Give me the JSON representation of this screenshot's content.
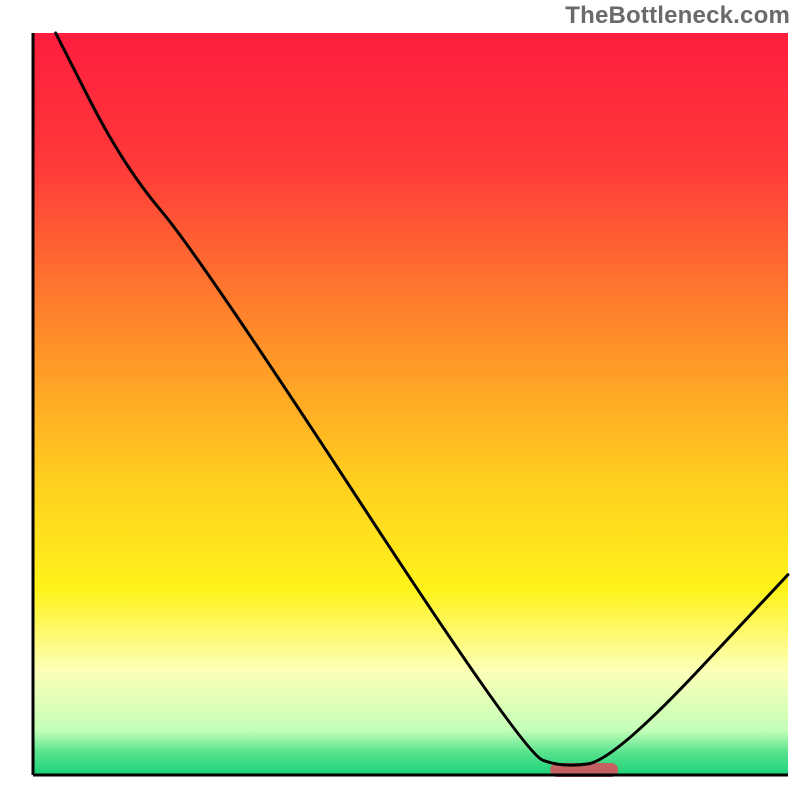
{
  "watermark": "TheBottleneck.com",
  "chart_data": {
    "type": "line",
    "title": "",
    "xlabel": "",
    "ylabel": "",
    "xlim": [
      0,
      100
    ],
    "ylim": [
      0,
      100
    ],
    "background_gradient": {
      "stops": [
        {
          "offset": 0,
          "color": "#ff1d3e"
        },
        {
          "offset": 18,
          "color": "#ff3a3a"
        },
        {
          "offset": 40,
          "color": "#ff8a2a"
        },
        {
          "offset": 60,
          "color": "#ffce1f"
        },
        {
          "offset": 75,
          "color": "#fff31a"
        },
        {
          "offset": 86,
          "color": "#fdffb8"
        },
        {
          "offset": 94,
          "color": "#c3ffb8"
        },
        {
          "offset": 97,
          "color": "#57e28d"
        },
        {
          "offset": 100,
          "color": "#1bd17a"
        }
      ]
    },
    "series": [
      {
        "name": "bottleneck-curve",
        "color": "#000000",
        "points": [
          {
            "x": 3,
            "y": 100
          },
          {
            "x": 12,
            "y": 82
          },
          {
            "x": 22,
            "y": 70
          },
          {
            "x": 65,
            "y": 3
          },
          {
            "x": 70,
            "y": 1
          },
          {
            "x": 77,
            "y": 2
          },
          {
            "x": 100,
            "y": 27
          }
        ]
      }
    ],
    "marker": {
      "name": "optimal-point",
      "x": 73,
      "width": 9,
      "color": "#c46060"
    },
    "axes": {
      "color": "#000000",
      "width": 3
    }
  }
}
